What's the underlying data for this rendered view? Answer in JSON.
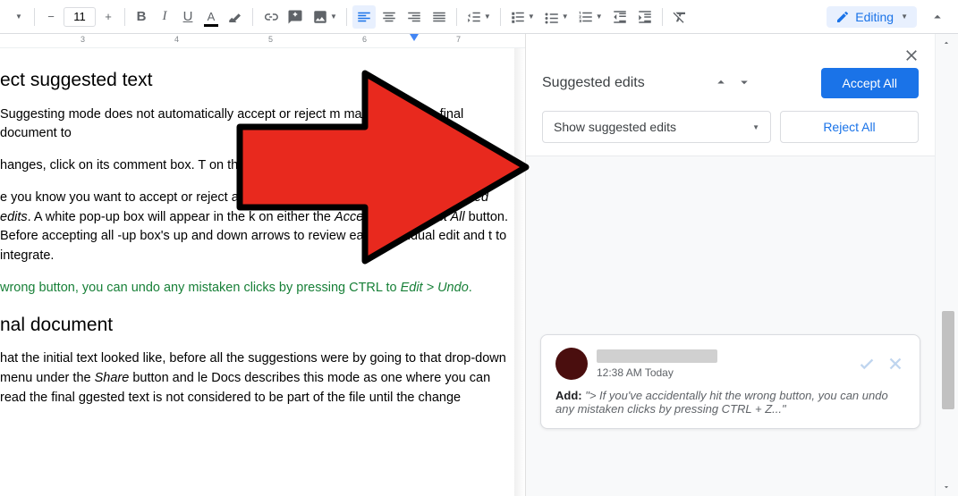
{
  "toolbar": {
    "font_size": "11",
    "bold": "B",
    "italic": "I",
    "underline": "U",
    "text_color": "A"
  },
  "editing_mode": {
    "label": "Editing"
  },
  "ruler": {
    "numbers": [
      "3",
      "4",
      "5",
      "6",
      "7"
    ]
  },
  "document": {
    "heading1": "ect suggested text",
    "p1": " Suggesting mode does not automatically accept or reject m manually for the final document to",
    "p2": "hanges, click on its comment box. T on the X icon to reject it.",
    "p3a": "e you know you want to accept or reject all changes, you can do ",
    "p3b_italic": "> Review suggested edits",
    "p3c": ". A white pop-up box will appear in the k on either the ",
    "p3d_italic": "Accept All",
    "p3e": " or ",
    "p3f_italic": "Reject All",
    "p3g": " button. Before accepting all -up box's up and down arrows to review each individual edit and t to integrate.",
    "p4a": " wrong button, you can undo any mistaken clicks by pressing CTRL  to ",
    "p4b_italic": "Edit > Undo",
    "p4c": ".",
    "heading2": "nal document",
    "p5a": " hat the initial text looked like, before all the suggestions were  by going to that drop-down menu under the ",
    "p5b_italic": "Share",
    "p5c": " button and le Docs describes this mode as one where you can read the final ggested text is not considered to be part of the file until the change"
  },
  "suggested_edits": {
    "title": "Suggested edits",
    "accept_all": "Accept All",
    "dropdown": "Show suggested edits",
    "reject_all": "Reject All"
  },
  "comment": {
    "time": "12:38 AM Today",
    "add_label": "Add:",
    "quote": "\"> If you've accidentally hit the wrong button, you can undo any mistaken clicks by pressing CTRL + Z...\""
  }
}
